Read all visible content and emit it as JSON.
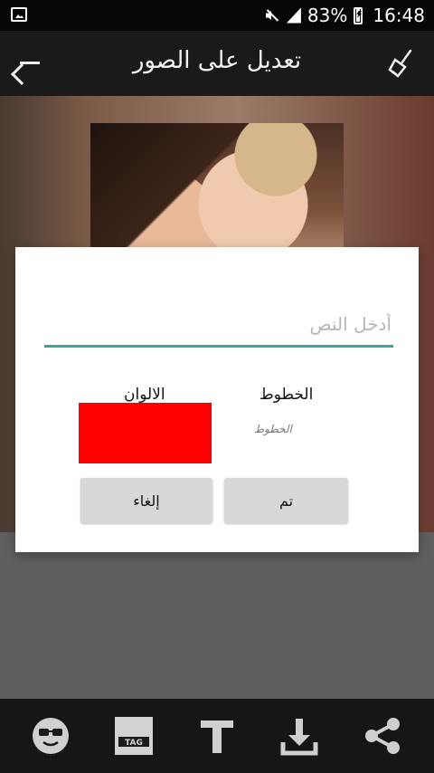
{
  "status_bar": {
    "battery_percent": "83%",
    "time": "16:48",
    "icons": [
      "image-icon",
      "mute-icon",
      "signal-icon",
      "battery-icon"
    ]
  },
  "toolbar": {
    "title": "تعديل على الصور",
    "back_icon": "back-arrow-icon",
    "action_icon": "broom-icon"
  },
  "dialog": {
    "text_input": {
      "value": "",
      "placeholder": "أدخل النص"
    },
    "fonts_label": "الخطوط",
    "colors_label": "الالوان",
    "font_sample": "الخطوط",
    "selected_color": "#ff0000",
    "cancel_label": "إلغاء",
    "done_label": "تم"
  },
  "bottom_bar": {
    "icons": [
      "emoji-icon",
      "tag-icon",
      "text-icon",
      "download-icon",
      "share-icon"
    ],
    "tag_text": "TAG"
  },
  "colors": {
    "accent": "#3aa597",
    "toolbar_bg": "#1a1a1a",
    "dialog_bg": "#ffffff",
    "button_bg": "#d8d8d8"
  }
}
